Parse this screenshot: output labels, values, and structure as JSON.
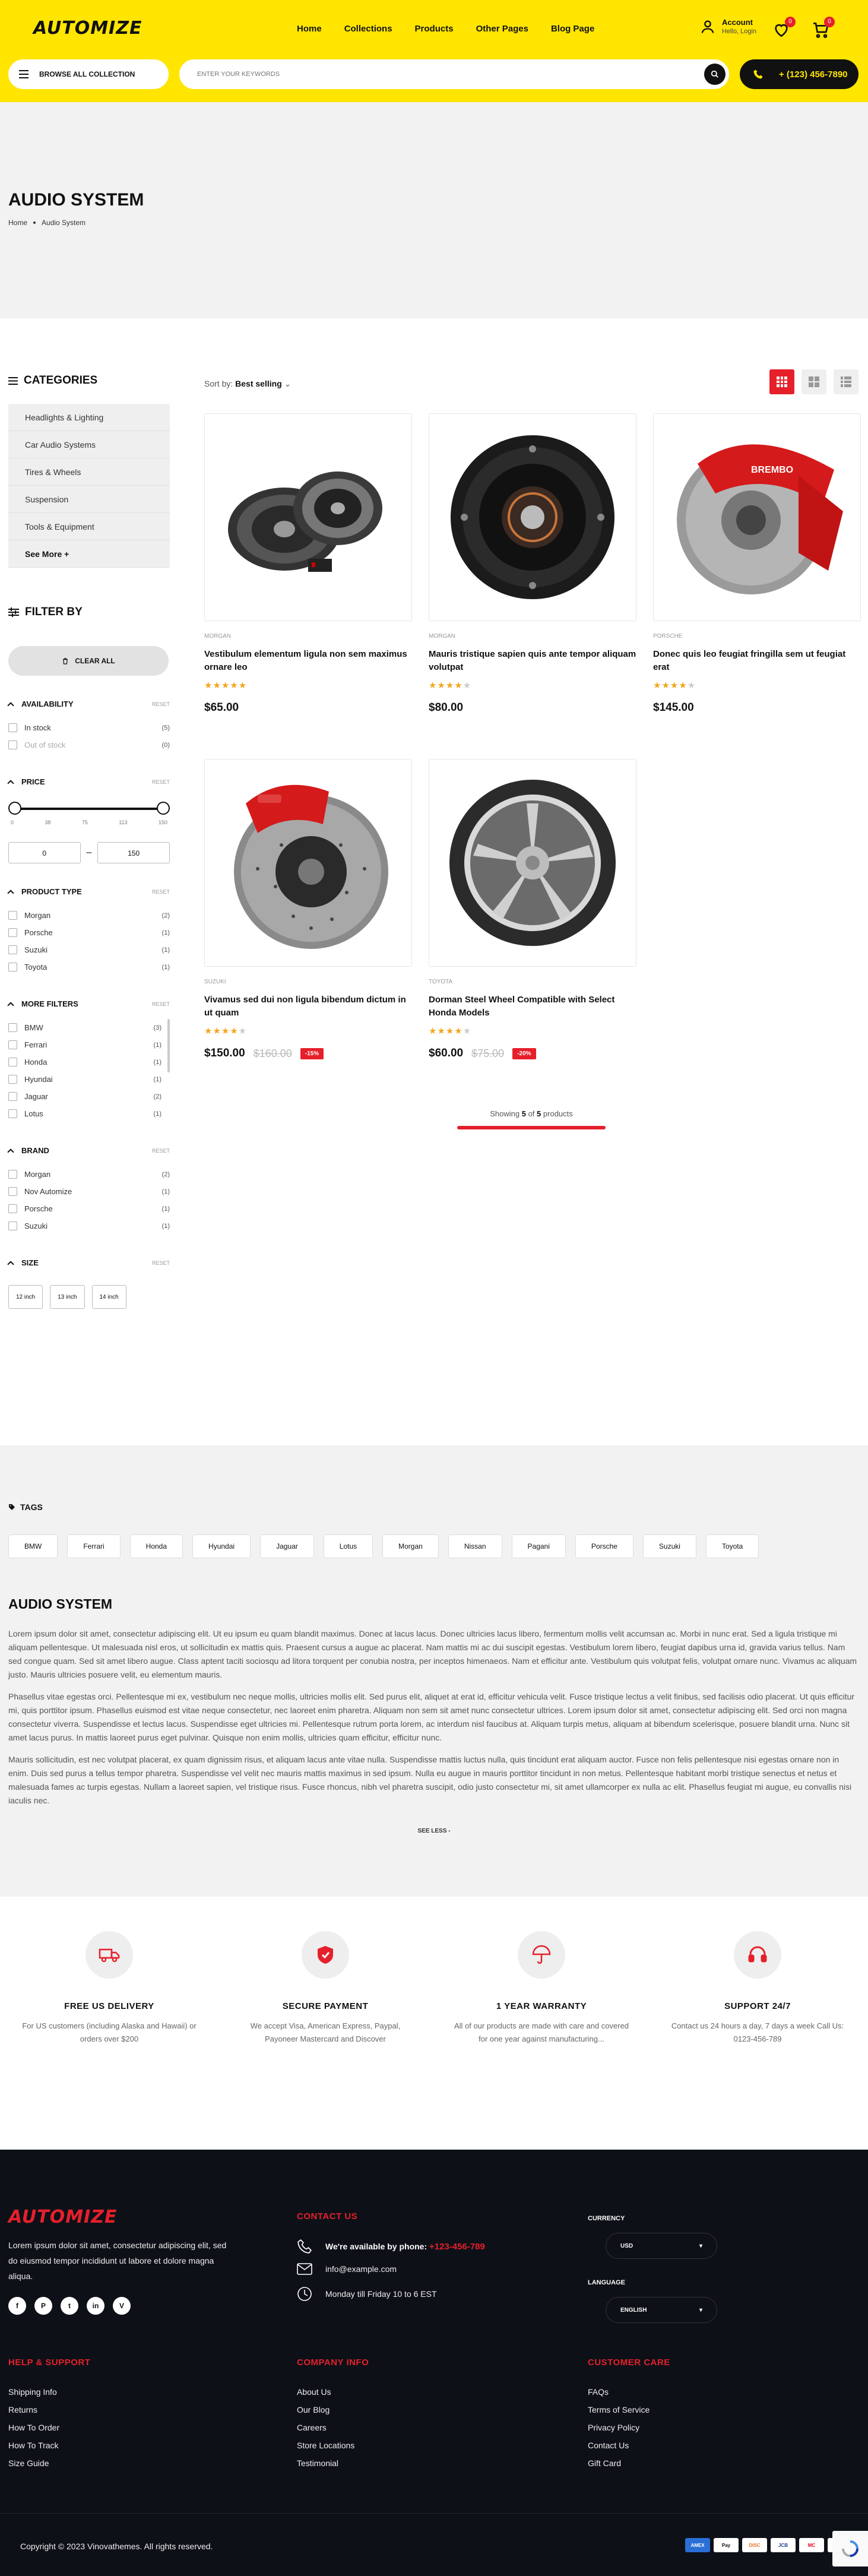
{
  "header": {
    "logo": "AUTOMIZE",
    "nav": [
      "Home",
      "Collections",
      "Products",
      "Other Pages",
      "Blog Page"
    ],
    "account_title": "Account",
    "account_sub": "Hello, Login",
    "wishlist_count": "0",
    "cart_count": "0",
    "browse_label": "BROWSE ALL COLLECTION",
    "search_placeholder": "ENTER YOUR KEYWORDS",
    "phone": "+ (123) 456-7890"
  },
  "banner": {
    "title": "AUDIO SYSTEM",
    "breadcrumb": [
      "Home",
      "Audio System"
    ]
  },
  "sidebar": {
    "categories_title": "CATEGORIES",
    "categories": [
      "Headlights & Lighting",
      "Car Audio Systems",
      "Tires & Wheels",
      "Suspension",
      "Tools & Equipment",
      "See More +"
    ],
    "filter_title": "FILTER BY",
    "clear_all": "CLEAR ALL",
    "reset": "RESET",
    "availability": {
      "title": "AVAILABILITY",
      "items": [
        {
          "label": "In stock",
          "count": "(5)"
        },
        {
          "label": "Out of stock",
          "count": "(0)"
        }
      ]
    },
    "price": {
      "title": "PRICE",
      "ticks": [
        "0",
        "38",
        "75",
        "113",
        "150"
      ],
      "min": "0",
      "max": "150",
      "separator": "–"
    },
    "product_type": {
      "title": "PRODUCT TYPE",
      "items": [
        {
          "label": "Morgan",
          "count": "(2)"
        },
        {
          "label": "Porsche",
          "count": "(1)"
        },
        {
          "label": "Suzuki",
          "count": "(1)"
        },
        {
          "label": "Toyota",
          "count": "(1)"
        }
      ]
    },
    "more_filters": {
      "title": "MORE FILTERS",
      "items": [
        {
          "label": "BMW",
          "count": "(3)"
        },
        {
          "label": "Ferrari",
          "count": "(1)"
        },
        {
          "label": "Honda",
          "count": "(1)"
        },
        {
          "label": "Hyundai",
          "count": "(1)"
        },
        {
          "label": "Jaguar",
          "count": "(2)"
        },
        {
          "label": "Lotus",
          "count": "(1)"
        }
      ]
    },
    "brand": {
      "title": "BRAND",
      "items": [
        {
          "label": "Morgan",
          "count": "(2)"
        },
        {
          "label": "Nov Automize",
          "count": "(1)"
        },
        {
          "label": "Porsche",
          "count": "(1)"
        },
        {
          "label": "Suzuki",
          "count": "(1)"
        }
      ]
    },
    "size": {
      "title": "SIZE",
      "items": [
        "12 inch",
        "13 inch",
        "14 inch"
      ]
    }
  },
  "toolbar": {
    "sort_label": "Sort by:",
    "sort_value": "Best selling"
  },
  "products": [
    {
      "brand": "MORGAN",
      "name": "Vestibulum elementum ligula non sem maximus ornare leo",
      "rating": 5,
      "stars": "★★★★★",
      "price": "$65.00",
      "old": "",
      "discount": ""
    },
    {
      "brand": "MORGAN",
      "name": "Mauris tristique sapien quis ante tempor aliquam volutpat",
      "rating": 4.5,
      "stars": "★★★★",
      "price": "$80.00",
      "old": "",
      "discount": ""
    },
    {
      "brand": "PORSCHE",
      "name": "Donec quis leo feugiat fringilla sem ut feugiat erat",
      "rating": 4.5,
      "stars": "★★★★",
      "price": "$145.00",
      "old": "",
      "discount": ""
    },
    {
      "brand": "SUZUKI",
      "name": "Vivamus sed dui non ligula bibendum dictum in ut quam",
      "rating": 4,
      "stars": "★★★★",
      "price": "$150.00",
      "old": "$160.00",
      "discount": "-15%"
    },
    {
      "brand": "TOYOTA",
      "name": "Dorman Steel Wheel Compatible with Select Honda Models",
      "rating": 4.5,
      "stars": "★★★★",
      "price": "$60.00",
      "old": "$75.00",
      "discount": "-20%"
    }
  ],
  "pagination": {
    "prefix": "Showing",
    "shown": "5",
    "middle": "of",
    "total": "5",
    "suffix": "products"
  },
  "tags": {
    "title": "TAGS",
    "items": [
      "BMW",
      "Ferrari",
      "Honda",
      "Hyundai",
      "Jaguar",
      "Lotus",
      "Morgan",
      "Nissan",
      "Pagani",
      "Porsche",
      "Suzuki",
      "Toyota"
    ]
  },
  "seo": {
    "title": "AUDIO SYSTEM",
    "p1": "Lorem ipsum dolor sit amet, consectetur adipiscing elit. Ut eu ipsum eu quam blandit maximus. Donec at lacus lacus. Donec ultricies lacus libero, fermentum mollis velit accumsan ac. Morbi in nunc erat. Sed a ligula tristique mi aliquam pellentesque. Ut malesuada nisl eros, ut sollicitudin ex mattis quis. Praesent cursus a augue ac placerat. Nam mattis mi ac dui suscipit egestas. Vestibulum lorem libero, feugiat dapibus urna id, gravida varius tellus. Nam sed congue quam. Sed sit amet libero augue. Class aptent taciti sociosqu ad litora torquent per conubia nostra, per inceptos himenaeos. Nam et efficitur ante. Vestibulum quis volutpat felis, volutpat ornare nunc. Vivamus ac aliquam justo. Mauris ultricies posuere velit, eu elementum mauris.",
    "p2": "Phasellus vitae egestas orci. Pellentesque mi ex, vestibulum nec neque mollis, ultricies mollis elit. Sed purus elit, aliquet at erat id, efficitur vehicula velit. Fusce tristique lectus a velit finibus, sed facilisis odio placerat. Ut quis efficitur mi, quis porttitor ipsum. Phasellus euismod est vitae neque consectetur, nec laoreet enim pharetra. Aliquam non sem sit amet nunc consectetur ultrices. Lorem ipsum dolor sit amet, consectetur adipiscing elit. Sed orci non magna consectetur viverra. Suspendisse et lectus lacus. Suspendisse eget ultricies mi. Pellentesque rutrum porta lorem, ac interdum nisl faucibus at. Aliquam turpis metus, aliquam at bibendum scelerisque, posuere blandit urna. Nunc sit amet lacus purus. In mattis laoreet purus eget pulvinar. Quisque non enim mollis, ultricies quam efficitur, efficitur nunc.",
    "p3": "Mauris sollicitudin, est nec volutpat placerat, ex quam dignissim risus, et aliquam lacus ante vitae nulla. Suspendisse mattis luctus nulla, quis tincidunt erat aliquam auctor. Fusce non felis pellentesque nisi egestas ornare non in enim. Duis sed purus a tellus tempor pharetra. Suspendisse vel velit nec mauris mattis maximus in sed ipsum. Nulla eu augue in mauris porttitor tincidunt in non metus. Pellentesque habitant morbi tristique senectus et netus et malesuada fames ac turpis egestas. Nullam a laoreet sapien, vel tristique risus. Fusce rhoncus, nibh vel pharetra suscipit, odio justo consectetur mi, sit amet ullamcorper ex nulla ac elit. Phasellus feugiat mi augue, eu convallis nisi iaculis nec.",
    "see_less": "SEE LESS -"
  },
  "features": [
    {
      "title": "FREE US DELIVERY",
      "desc": "For US customers (including Alaska and Hawaii) or orders over $200"
    },
    {
      "title": "SECURE PAYMENT",
      "desc": "We accept Visa, American Express, Paypal, Payoneer Mastercard and Discover"
    },
    {
      "title": "1 YEAR WARRANTY",
      "desc": "All of our products are made with care and covered for one year against manufacturing..."
    },
    {
      "title": "SUPPORT 24/7",
      "desc": "Contact us 24 hours a day, 7 days a week Call Us: 0123-456-789"
    }
  ],
  "footer": {
    "logo": "AUTOMIZE",
    "about": "Lorem ipsum dolor sit amet, consectetur adipiscing elit, sed do eiusmod tempor incididunt ut labore et dolore magna aliqua.",
    "socials": [
      "f",
      "P",
      "t",
      "in",
      "V"
    ],
    "contact_title": "CONTACT US",
    "phone_label": "We're available by phone:",
    "phone": "+123-456-789",
    "email": "info@example.com",
    "hours": "Monday till Friday 10 to 6 EST",
    "currency_label": "CURRENCY",
    "currency_value": "USD",
    "language_label": "LANGUAGE",
    "language_value": "ENGLISH",
    "help_title": "HELP & SUPPORT",
    "help_links": [
      "Shipping Info",
      "Returns",
      "How To Order",
      "How To Track",
      "Size Guide"
    ],
    "company_title": "COMPANY INFO",
    "company_links": [
      "About Us",
      "Our Blog",
      "Careers",
      "Store Locations",
      "Testimonial"
    ],
    "care_title": "CUSTOMER CARE",
    "care_links": [
      "FAQs",
      "Terms of Service",
      "Privacy Policy",
      "Contact Us",
      "Gift Card"
    ],
    "copyright": "Copyright © 2023 Vinovathemes. All rights reserved.",
    "payments": [
      "AMEX",
      "Pay",
      "DISC",
      "JCB",
      "MC",
      "PP"
    ]
  },
  "colors": {
    "brand_yellow": "#ffe500",
    "accent_red": "#e5202b",
    "footer_bg": "#0d1017",
    "star": "#f4a61a"
  }
}
